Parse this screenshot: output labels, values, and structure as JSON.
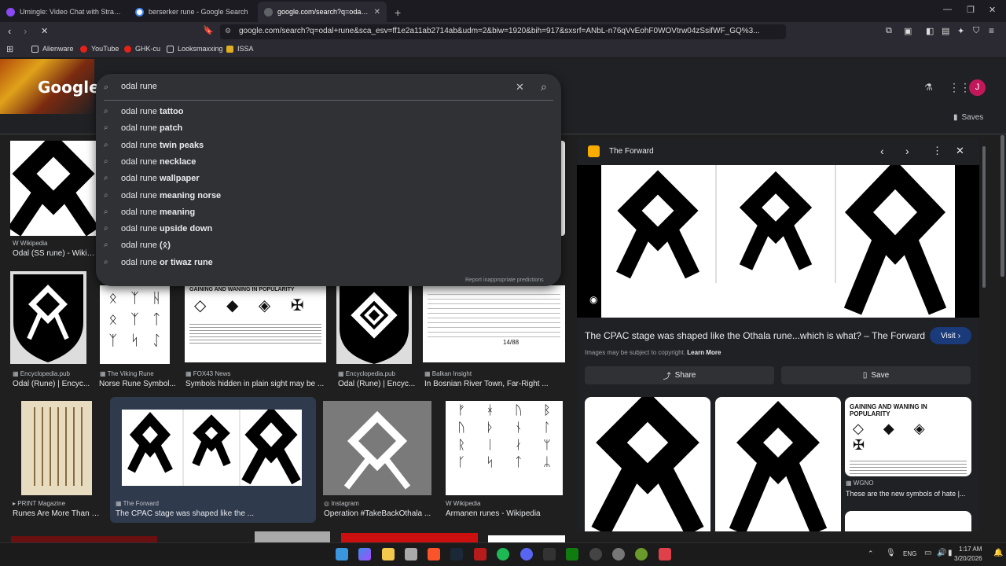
{
  "tabs": [
    {
      "title": "Umingle: Video Chat with Strange",
      "color": "#8a4af3"
    },
    {
      "title": "berserker rune - Google Search",
      "color": "#4285f4"
    },
    {
      "title": "google.com/search?q=odal+run",
      "color": "#5f6368"
    }
  ],
  "url": "google.com/search?q=odal+rune&sca_esv=ff1e2a11ab2714ab&udm=2&biw=1920&bih=917&sxsrf=ANbL-n76qVvEohF0WOVtrw04zSsifWF_GQ%3...",
  "bookmarks": [
    "Alienware",
    "YouTube",
    "GHK-cu",
    "Looksmaxxing",
    "ISSA"
  ],
  "logo_text": "Google",
  "avatar_letter": "J",
  "saves_label": "Saves",
  "search": {
    "query": "odal rune",
    "suggestions": [
      {
        "base": "odal rune ",
        "bold": "tattoo"
      },
      {
        "base": "odal rune ",
        "bold": "patch"
      },
      {
        "base": "odal rune ",
        "bold": "twin peaks"
      },
      {
        "base": "odal rune ",
        "bold": "necklace"
      },
      {
        "base": "odal rune ",
        "bold": "wallpaper"
      },
      {
        "base": "odal rune ",
        "bold": "meaning norse"
      },
      {
        "base": "odal rune ",
        "bold": "meaning"
      },
      {
        "base": "odal rune ",
        "bold": "upside down"
      },
      {
        "base": "odal rune ",
        "bold": "(ᛟ)"
      },
      {
        "base": "odal rune ",
        "bold": "or tiwaz rune"
      }
    ],
    "report": "Report inappropriate predictions"
  },
  "results_row1": [
    {
      "source": "Wikipedia",
      "title": "Odal (SS rune) - Wikiped..."
    }
  ],
  "results_row2": [
    {
      "source": "Encyclopedia.pub",
      "title": "Odal (Rune) | Encyc..."
    },
    {
      "source": "The Viking Rune",
      "title": "Norse Rune Symbol..."
    },
    {
      "source": "FOX43 News",
      "title": "Symbols hidden in plain sight may be ..."
    },
    {
      "source": "Encyclopedia.pub",
      "title": "Odal (Rune) | Encyc..."
    },
    {
      "source": "Balkan Insight",
      "title": "In Bosnian River Town, Far-Right ..."
    }
  ],
  "results_row3": [
    {
      "source": "PRINT Magazine",
      "title": "Runes Are More Than an..."
    },
    {
      "source": "The Forward",
      "title": "The CPAC stage was shaped like the ..."
    },
    {
      "source": "Instagram",
      "title": "Operation #TakeBackOthala ..."
    },
    {
      "source": "Wikipedia",
      "title": "Armanen runes - Wikipedia"
    }
  ],
  "fox_heading": "GAINING AND WANING IN POPULARITY",
  "page_counter": "14/88",
  "panel": {
    "source": "The Forward",
    "title": "The CPAC stage was shaped like the Othala rune...which is what? – The Forward",
    "visit": "Visit",
    "copyright": "Images may be subject to copyright.",
    "learn_more": "Learn More",
    "share": "Share",
    "save": "Save",
    "related_source": "WGNO",
    "related_title": "These are the new symbols of hate |...",
    "related_heading": "GAINING AND WANING IN POPULARITY"
  },
  "clock": {
    "time": "1:17 AM",
    "date": "3/20/2026"
  },
  "lang": "ENG"
}
